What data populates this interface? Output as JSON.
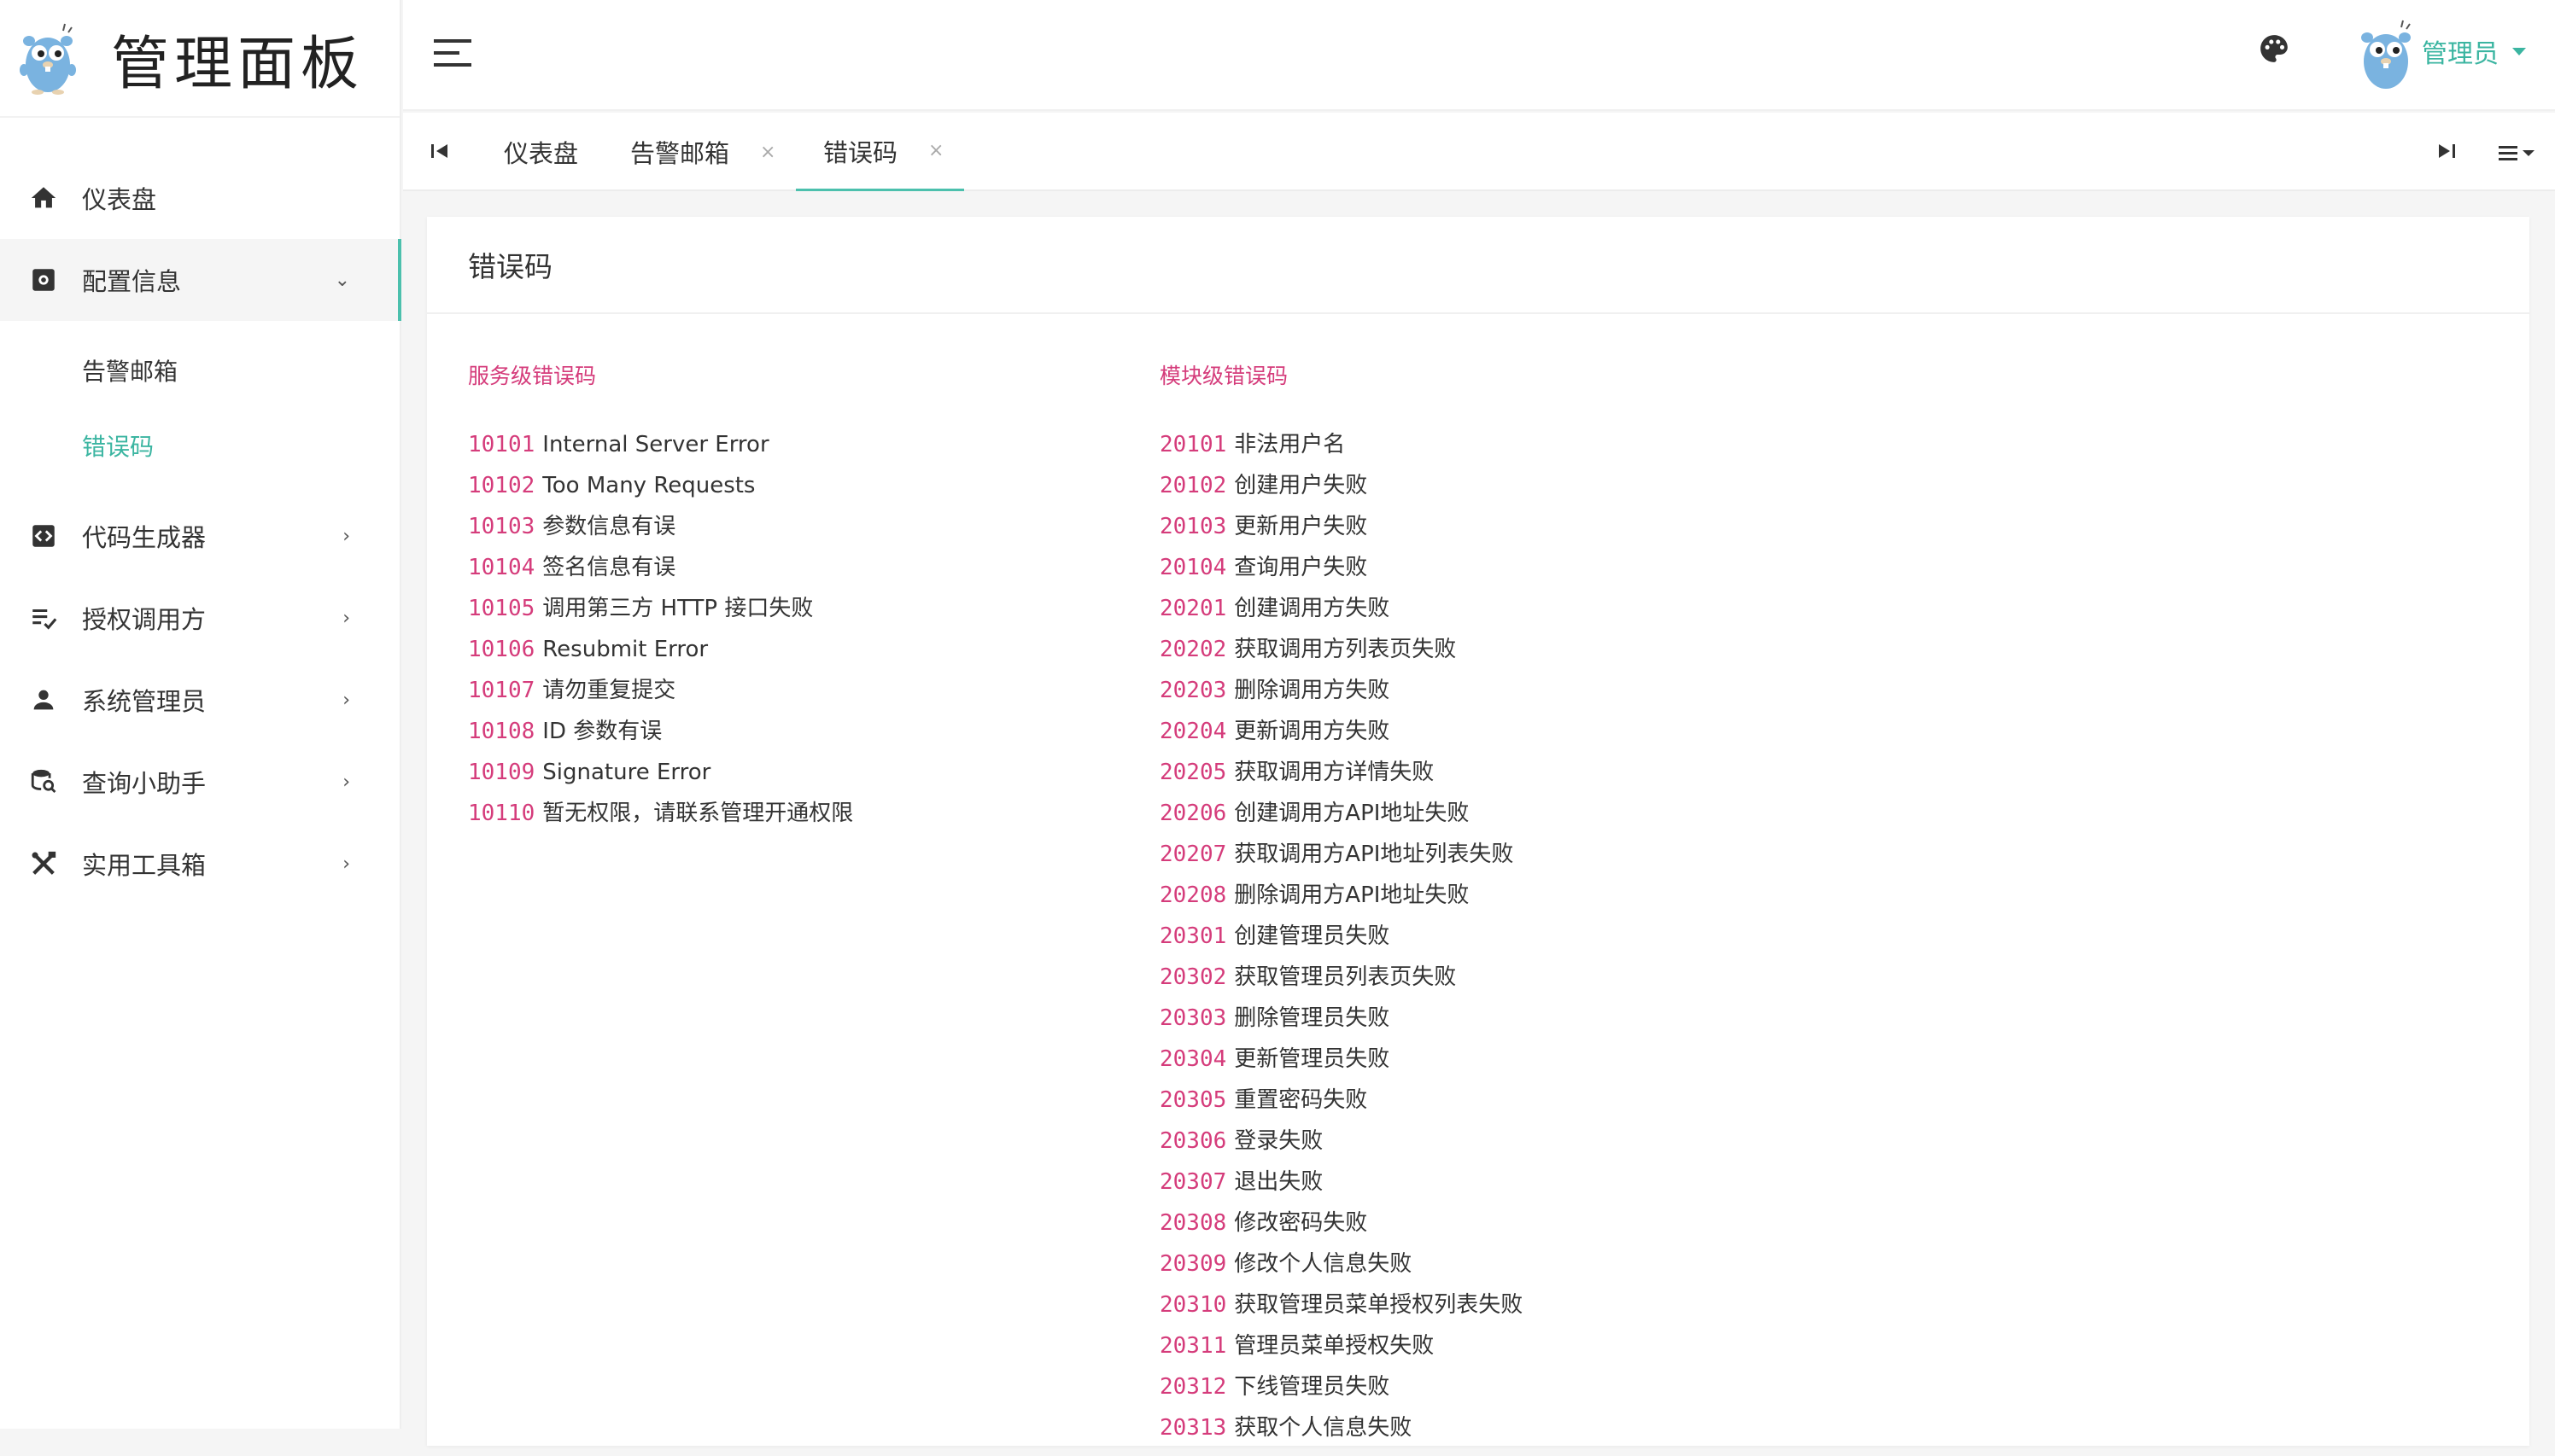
{
  "app": {
    "title": "管理面板"
  },
  "sidebar": {
    "items": [
      {
        "label": "仪表盘",
        "icon": "home-icon"
      },
      {
        "label": "配置信息",
        "icon": "gear-box-icon",
        "expanded": true,
        "children": [
          {
            "label": "告警邮箱"
          },
          {
            "label": "错误码",
            "active": true
          }
        ]
      },
      {
        "label": "代码生成器",
        "icon": "code-box-icon"
      },
      {
        "label": "授权调用方",
        "icon": "list-check-icon"
      },
      {
        "label": "系统管理员",
        "icon": "user-icon"
      },
      {
        "label": "查询小助手",
        "icon": "database-search-icon"
      },
      {
        "label": "实用工具箱",
        "icon": "tools-icon"
      }
    ]
  },
  "header": {
    "user": "管理员"
  },
  "tabs": [
    {
      "label": "仪表盘",
      "closable": false
    },
    {
      "label": "告警邮箱",
      "closable": true,
      "close": "×"
    },
    {
      "label": "错误码",
      "closable": true,
      "close": "×",
      "active": true
    }
  ],
  "page": {
    "title": "错误码",
    "service": {
      "title": "服务级错误码",
      "rows": [
        {
          "code": "10101",
          "desc": "Internal Server Error"
        },
        {
          "code": "10102",
          "desc": "Too Many Requests"
        },
        {
          "code": "10103",
          "desc": "参数信息有误"
        },
        {
          "code": "10104",
          "desc": "签名信息有误"
        },
        {
          "code": "10105",
          "desc": "调用第三方 HTTP 接口失败"
        },
        {
          "code": "10106",
          "desc": "Resubmit Error"
        },
        {
          "code": "10107",
          "desc": "请勿重复提交"
        },
        {
          "code": "10108",
          "desc": "ID 参数有误"
        },
        {
          "code": "10109",
          "desc": "Signature Error"
        },
        {
          "code": "10110",
          "desc": "暂无权限，请联系管理开通权限"
        }
      ]
    },
    "module": {
      "title": "模块级错误码",
      "rows": [
        {
          "code": "20101",
          "desc": "非法用户名"
        },
        {
          "code": "20102",
          "desc": "创建用户失败"
        },
        {
          "code": "20103",
          "desc": "更新用户失败"
        },
        {
          "code": "20104",
          "desc": "查询用户失败"
        },
        {
          "code": "20201",
          "desc": "创建调用方失败"
        },
        {
          "code": "20202",
          "desc": "获取调用方列表页失败"
        },
        {
          "code": "20203",
          "desc": "删除调用方失败"
        },
        {
          "code": "20204",
          "desc": "更新调用方失败"
        },
        {
          "code": "20205",
          "desc": "获取调用方详情失败"
        },
        {
          "code": "20206",
          "desc": "创建调用方API地址失败"
        },
        {
          "code": "20207",
          "desc": "获取调用方API地址列表失败"
        },
        {
          "code": "20208",
          "desc": "删除调用方API地址失败"
        },
        {
          "code": "20301",
          "desc": "创建管理员失败"
        },
        {
          "code": "20302",
          "desc": "获取管理员列表页失败"
        },
        {
          "code": "20303",
          "desc": "删除管理员失败"
        },
        {
          "code": "20304",
          "desc": "更新管理员失败"
        },
        {
          "code": "20305",
          "desc": "重置密码失败"
        },
        {
          "code": "20306",
          "desc": "登录失败"
        },
        {
          "code": "20307",
          "desc": "退出失败"
        },
        {
          "code": "20308",
          "desc": "修改密码失败"
        },
        {
          "code": "20309",
          "desc": "修改个人信息失败"
        },
        {
          "code": "20310",
          "desc": "获取管理员菜单授权列表失败"
        },
        {
          "code": "20311",
          "desc": "管理员菜单授权失败"
        },
        {
          "code": "20312",
          "desc": "下线管理员失败"
        },
        {
          "code": "20313",
          "desc": "获取个人信息失败"
        }
      ]
    }
  },
  "colors": {
    "accent": "#4cc0ad",
    "code": "#d53c7b",
    "mascot": "#7ab3e0"
  }
}
